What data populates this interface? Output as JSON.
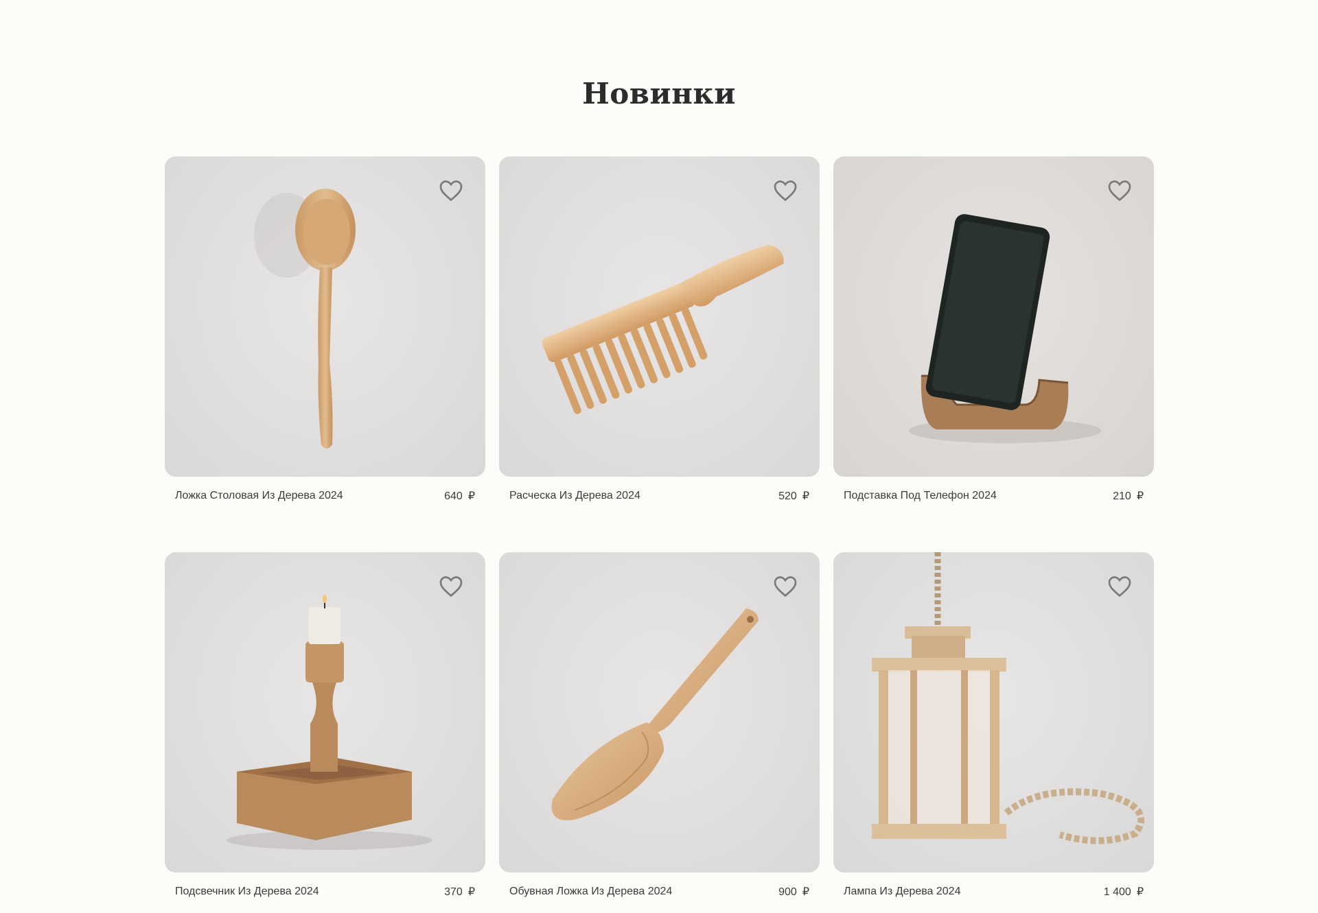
{
  "section": {
    "title": "Новинки"
  },
  "currency_symbol": "₽",
  "products": [
    {
      "name": "Ложка Столовая Из Дерева 2024",
      "price": "640",
      "image_icon": "wooden-spoon"
    },
    {
      "name": "Расческа Из Дерева 2024",
      "price": "520",
      "image_icon": "wooden-comb"
    },
    {
      "name": "Подставка Под Телефон 2024",
      "price": "210",
      "image_icon": "phone-stand"
    },
    {
      "name": "Подсвечник Из Дерева 2024",
      "price": "370",
      "image_icon": "wooden-candle-holder"
    },
    {
      "name": "Обувная Ложка Из Дерева 2024",
      "price": "900",
      "image_icon": "shoehorn"
    },
    {
      "name": "Лампа Из Дерева 2024",
      "price": "1 400",
      "image_icon": "wooden-lantern"
    }
  ],
  "colors": {
    "background": "#fbfdf8",
    "wood": "#d9b48a",
    "heart_outline": "#7a7a7a"
  }
}
